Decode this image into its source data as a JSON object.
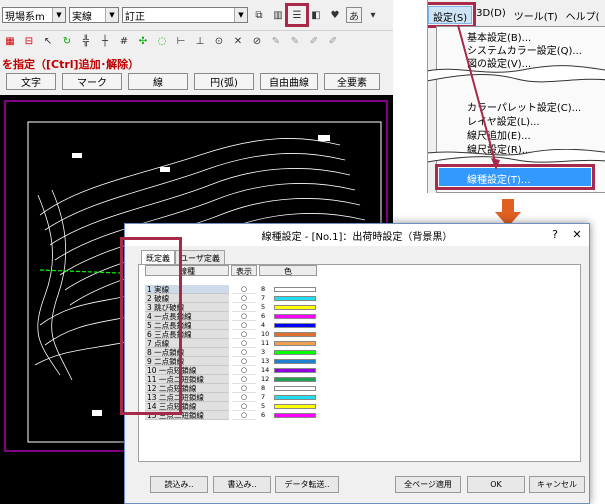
{
  "cad": {
    "layer_combo": "現場系m",
    "linetype_combo": "実線",
    "mode_combo": "訂正",
    "prompt": "を指定（[Ctrl]追加･解除）",
    "filters": [
      "文字",
      "マーク",
      "線",
      "円(弧)",
      "自由曲線",
      "全要素"
    ]
  },
  "menu": {
    "bar": [
      "設定(S)",
      "3D(D)",
      "ツール(T)",
      "ヘルプ("
    ],
    "items": [
      "基本設定(B)...",
      "システムカラー設定(Q)...",
      "図の設定(V)...",
      "カラーパレット設定(C)...",
      "レイヤ設定(L)...",
      "線尺追加(E)...",
      "線尺設定(R)...",
      "",
      "線種設定(T)..."
    ]
  },
  "dialog": {
    "title": "線種設定 - [No.1]：出荷時設定（背景黒）",
    "help": "?",
    "close": "✕",
    "tabs": [
      "既定義",
      "ユーザ定義"
    ],
    "headers": {
      "name": "線種",
      "visible": "表示",
      "color": "色"
    },
    "rows": [
      {
        "name": "1 実線",
        "vis": "○",
        "num": "8",
        "color": "#ffffff"
      },
      {
        "name": "2 破線",
        "vis": "○",
        "num": "7",
        "color": "#22ddee"
      },
      {
        "name": "3 跳び破線",
        "vis": "○",
        "num": "5",
        "color": "#ffff00"
      },
      {
        "name": "4 一点長鎖線",
        "vis": "○",
        "num": "6",
        "color": "#ff00ff"
      },
      {
        "name": "5 二点長鎖線",
        "vis": "○",
        "num": "4",
        "color": "#0000ff"
      },
      {
        "name": "6 三点長鎖線",
        "vis": "○",
        "num": "10",
        "color": "#e07030"
      },
      {
        "name": "7 点線",
        "vis": "○",
        "num": "11",
        "color": "#f0a050"
      },
      {
        "name": "8 一点鎖線",
        "vis": "○",
        "num": "3",
        "color": "#00ff00"
      },
      {
        "name": "9 二点鎖線",
        "vis": "○",
        "num": "13",
        "color": "#2080d0"
      },
      {
        "name": "10 一点短鎖線",
        "vis": "○",
        "num": "14",
        "color": "#9000e0"
      },
      {
        "name": "11 一点二短鎖線",
        "vis": "○",
        "num": "12",
        "color": "#20a050"
      },
      {
        "name": "12 二点短鎖線",
        "vis": "○",
        "num": "8",
        "color": "#ffffff"
      },
      {
        "name": "13 二点二短鎖線",
        "vis": "○",
        "num": "7",
        "color": "#22ddee"
      },
      {
        "name": "14 三点短鎖線",
        "vis": "○",
        "num": "5",
        "color": "#ffff00"
      },
      {
        "name": "15 三点二短鎖線",
        "vis": "○",
        "num": "6",
        "color": "#ff00ff"
      }
    ],
    "buttons": {
      "read": "読込み..",
      "write": "書込み..",
      "transfer": "データ転送..",
      "apply_all": "全ページ適用",
      "ok": "OK",
      "cancel": "キャンセル"
    }
  },
  "colors": {
    "highlight": "#a8294a",
    "arrow": "#e06020",
    "selected_menu": "#3399ff"
  }
}
